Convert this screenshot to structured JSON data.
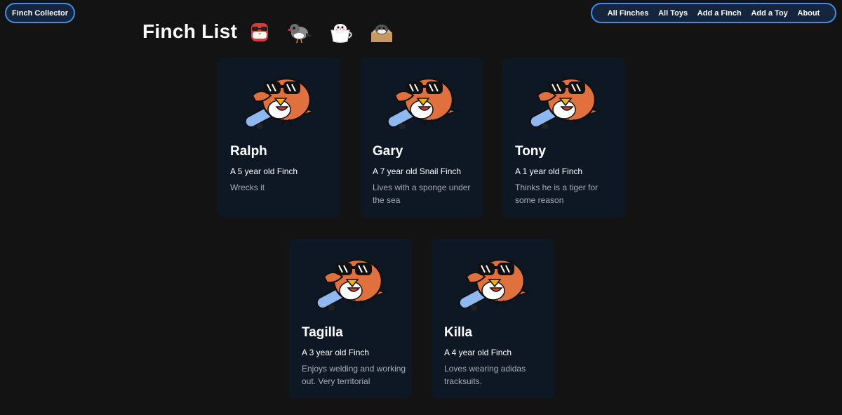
{
  "navbar": {
    "brand_label": "Finch Collector",
    "links": [
      {
        "label": "All Finches"
      },
      {
        "label": "All Toys"
      },
      {
        "label": "Add a Finch"
      },
      {
        "label": "Add a Toy"
      },
      {
        "label": "About"
      }
    ],
    "accent_color": "#3d8ee6"
  },
  "page": {
    "title": "Finch List",
    "title_icons": [
      "finch-sunglasses-icon",
      "zebra-finch-icon",
      "finch-in-teacup-icon",
      "finch-in-box-icon"
    ]
  },
  "finches": [
    {
      "name": "Ralph",
      "age": "A 5 year old Finch",
      "description": "Wrecks it",
      "image": "skateboarding-finch-icon"
    },
    {
      "name": "Gary",
      "age": "A 7 year old Snail Finch",
      "description": "Lives with a sponge under the sea",
      "image": "skateboarding-finch-icon"
    },
    {
      "name": "Tony",
      "age": "A 1 year old Finch",
      "description": "Thinks he is a tiger for some reason",
      "image": "skateboarding-finch-icon"
    },
    {
      "name": "Tagilla",
      "age": "A 3 year old Finch",
      "description": "Enjoys welding and working out. Very territorial",
      "image": "skateboarding-finch-icon"
    },
    {
      "name": "Killa",
      "age": "A 4 year old Finch",
      "description": "Loves wearing adidas tracksuits.",
      "image": "skateboarding-finch-icon"
    }
  ]
}
